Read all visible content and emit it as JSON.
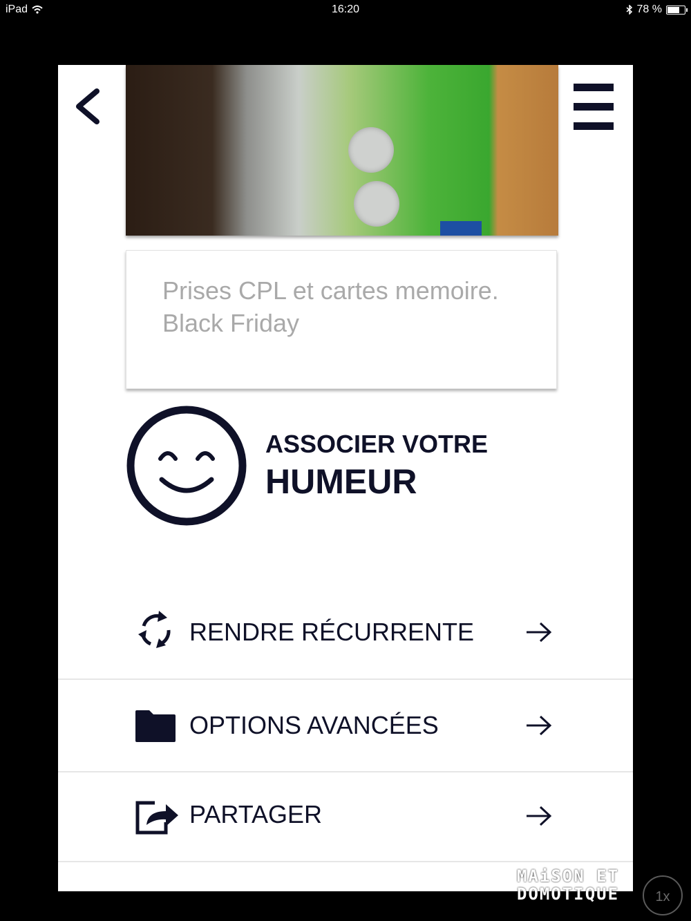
{
  "status_bar": {
    "device": "iPad",
    "time": "16:20",
    "battery": "78 %",
    "battery_level": 0.78
  },
  "header": {
    "back_icon": "chevron-left-icon",
    "menu_icon": "hamburger-menu-icon"
  },
  "note": {
    "text": "Prises CPL et cartes memoire. Black Friday"
  },
  "mood": {
    "line1": "ASSOCIER VOTRE",
    "line2": "HUMEUR",
    "icon": "smiley-icon"
  },
  "actions": [
    {
      "label": "RENDRE RÉCURRENTE",
      "icon": "recurrence-icon"
    },
    {
      "label": "OPTIONS AVANCÉES",
      "icon": "folder-icon"
    },
    {
      "label": "PARTAGER",
      "icon": "share-icon"
    }
  ],
  "watermark": {
    "line1": "MAiSON ET",
    "line2": "DOMOTIQUE"
  },
  "zoom_button": "1x",
  "colors": {
    "primary": "#0f1128",
    "placeholder": "#a9a9a9",
    "background": "#000000",
    "panel": "#ffffff"
  }
}
